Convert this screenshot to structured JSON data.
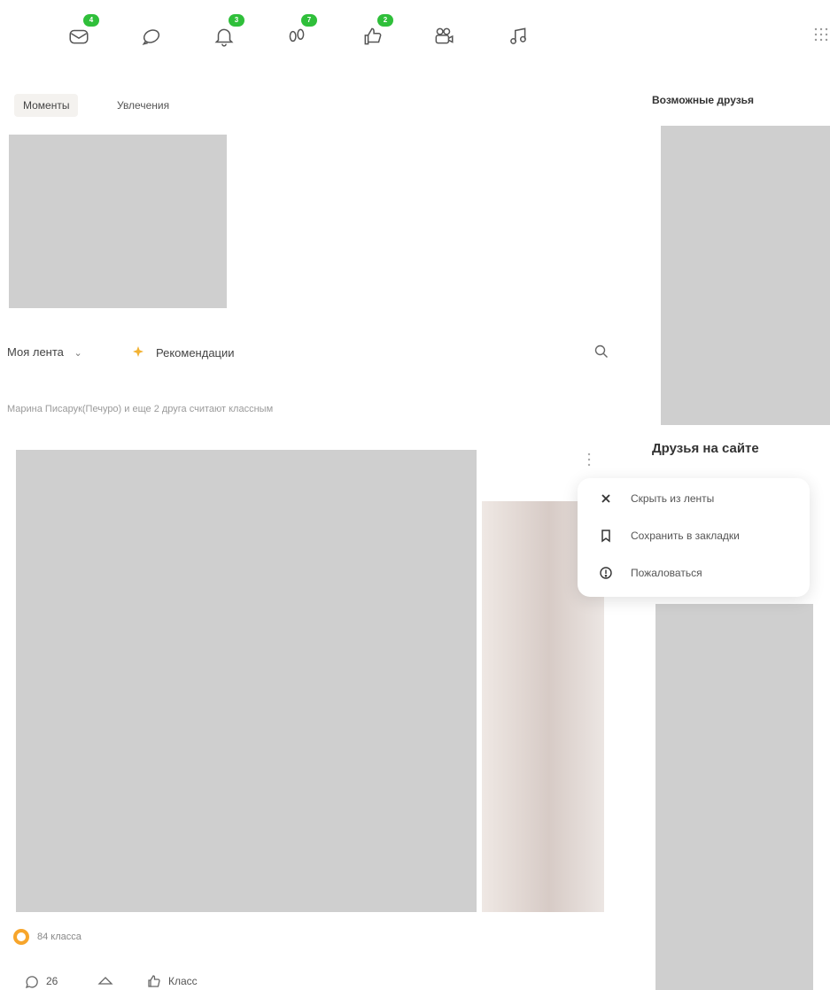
{
  "nav": {
    "items": [
      {
        "name": "messages",
        "badge": "4"
      },
      {
        "name": "discussions",
        "badge": ""
      },
      {
        "name": "notifications",
        "badge": "3"
      },
      {
        "name": "guests",
        "badge": "7"
      },
      {
        "name": "events",
        "badge": "2"
      },
      {
        "name": "video",
        "badge": ""
      },
      {
        "name": "music",
        "badge": ""
      }
    ],
    "accent": "#2fbf3a"
  },
  "tabs": [
    {
      "label": "Моменты",
      "active": true
    },
    {
      "label": "Увлечения",
      "active": false
    }
  ],
  "feed": {
    "selector_label": "Моя лента",
    "recommendations_label": "Рекомендации",
    "activity_text": "Марина Писарук(Печуро) и еще 2 друга считают классным",
    "classes_count_label": "84 класса",
    "comments_count": "26",
    "like_label": "Класс"
  },
  "sidebar": {
    "possible_friends_title": "Возможные друзья",
    "friends_online_title": "Друзья на сайте"
  },
  "context_menu": {
    "items": [
      {
        "label": "Скрыть из ленты",
        "icon": "close-icon"
      },
      {
        "label": "Сохранить в закладки",
        "icon": "bookmark-icon"
      },
      {
        "label": "Пожаловаться",
        "icon": "report-icon"
      }
    ]
  }
}
